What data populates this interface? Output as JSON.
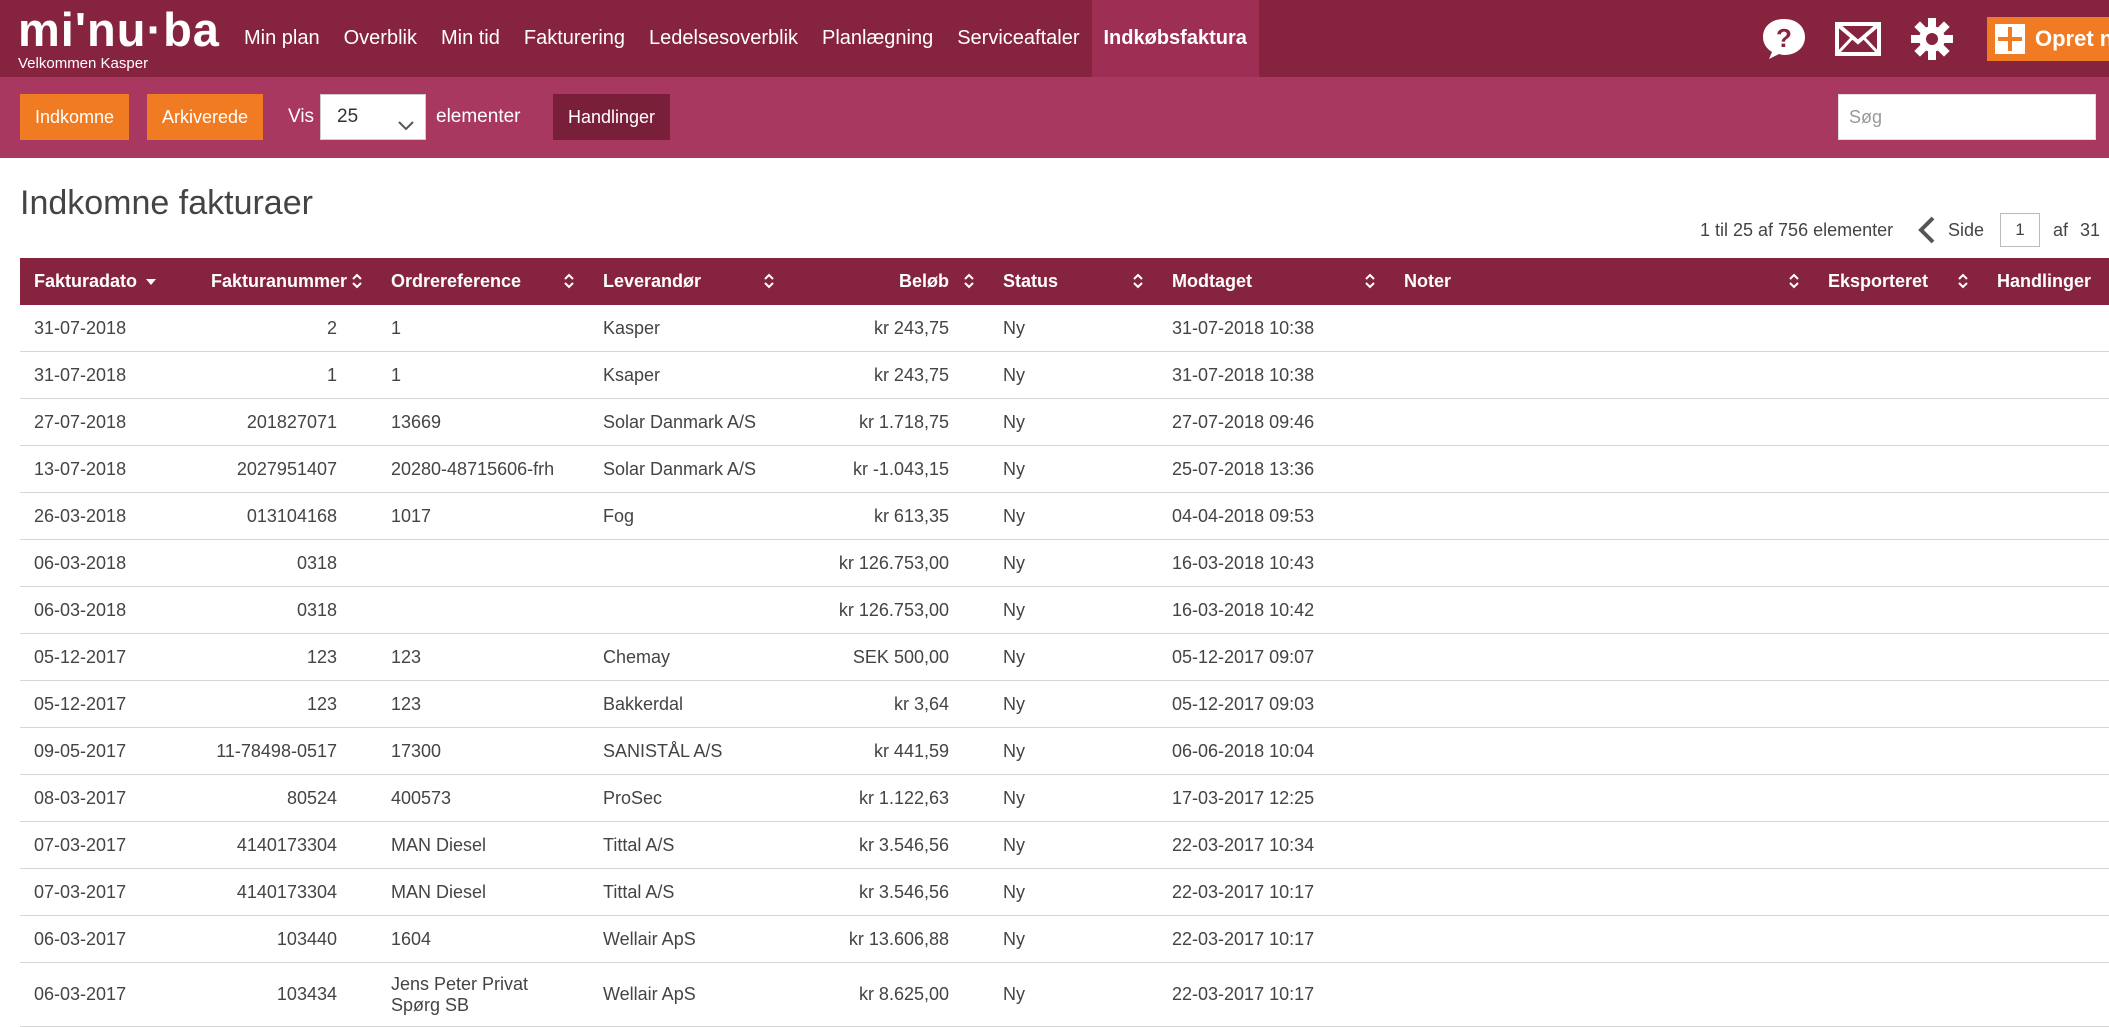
{
  "nav": {
    "logo_text": "mi'nu·ba",
    "welcome": "Velkommen  Kasper",
    "items": [
      {
        "label": "Min plan",
        "name": "nav-min-plan"
      },
      {
        "label": "Overblik",
        "name": "nav-overblik"
      },
      {
        "label": "Min tid",
        "name": "nav-min-tid"
      },
      {
        "label": "Fakturering",
        "name": "nav-fakturering"
      },
      {
        "label": "Ledelsesoverblik",
        "name": "nav-ledelsesoverblik"
      },
      {
        "label": "Planlægning",
        "name": "nav-planlaegning"
      },
      {
        "label": "Serviceaftaler",
        "name": "nav-serviceaftaler"
      },
      {
        "label": "Indkøbsfaktura",
        "name": "nav-indkobsfaktura",
        "active": true
      }
    ],
    "icons": [
      "help-icon",
      "mail-icon",
      "gear-icon"
    ],
    "create_label": "Opret n"
  },
  "toolbar": {
    "incoming_label": "Indkomne",
    "archived_label": "Arkiverede",
    "show_label": "Vis",
    "page_size": "25",
    "elements_label": "elementer",
    "actions_label": "Handlinger",
    "search_placeholder": "Søg"
  },
  "page": {
    "title": "Indkomne fakturaer",
    "range_text": "1 til 25 af 756 elementer",
    "page_label": "Side",
    "current_page": "1",
    "of_label": "af",
    "total_pages": "31"
  },
  "table": {
    "columns": [
      {
        "key": "date",
        "label": "Fakturadato",
        "sorted": true
      },
      {
        "key": "number",
        "label": "Fakturanummer",
        "align": "right"
      },
      {
        "key": "order_ref",
        "label": "Ordrereference"
      },
      {
        "key": "supplier",
        "label": "Leverandør"
      },
      {
        "key": "amount",
        "label": "Beløb",
        "align": "right"
      },
      {
        "key": "status",
        "label": "Status"
      },
      {
        "key": "received",
        "label": "Modtaget"
      },
      {
        "key": "notes",
        "label": "Noter"
      },
      {
        "key": "exported",
        "label": "Eksporteret"
      },
      {
        "key": "actions",
        "label": "Handlinger",
        "nosort": true
      }
    ],
    "rows": [
      {
        "date": "31-07-2018",
        "number": "2",
        "order_ref": "1",
        "supplier": "Kasper",
        "amount": "kr 243,75",
        "status": "Ny",
        "received": "31-07-2018 10:38"
      },
      {
        "date": "31-07-2018",
        "number": "1",
        "order_ref": "1",
        "supplier": "Ksaper",
        "amount": "kr 243,75",
        "status": "Ny",
        "received": "31-07-2018 10:38"
      },
      {
        "date": "27-07-2018",
        "number": "201827071",
        "order_ref": "13669",
        "supplier": "Solar Danmark A/S",
        "amount": "kr 1.718,75",
        "status": "Ny",
        "received": "27-07-2018 09:46"
      },
      {
        "date": "13-07-2018",
        "number": "2027951407",
        "order_ref": "20280-48715606-frh",
        "supplier": "Solar Danmark A/S",
        "amount": "kr -1.043,15",
        "status": "Ny",
        "received": "25-07-2018 13:36"
      },
      {
        "date": "26-03-2018",
        "number": "013104168",
        "order_ref": "1017",
        "supplier": "Fog",
        "amount": "kr 613,35",
        "status": "Ny",
        "received": "04-04-2018 09:53"
      },
      {
        "date": "06-03-2018",
        "number": "0318",
        "order_ref": "",
        "supplier": "",
        "amount": "kr 126.753,00",
        "status": "Ny",
        "received": "16-03-2018 10:43"
      },
      {
        "date": "06-03-2018",
        "number": "0318",
        "order_ref": "",
        "supplier": "",
        "amount": "kr 126.753,00",
        "status": "Ny",
        "received": "16-03-2018 10:42"
      },
      {
        "date": "05-12-2017",
        "number": "123",
        "order_ref": "123",
        "supplier": "Chemay",
        "amount": "SEK 500,00",
        "status": "Ny",
        "received": "05-12-2017 09:07"
      },
      {
        "date": "05-12-2017",
        "number": "123",
        "order_ref": "123",
        "supplier": "Bakkerdal",
        "amount": "kr 3,64",
        "status": "Ny",
        "received": "05-12-2017 09:03"
      },
      {
        "date": "09-05-2017",
        "number": "11-78498-0517",
        "order_ref": "17300",
        "supplier": "SANISTÅL A/S",
        "amount": "kr 441,59",
        "status": "Ny",
        "received": "06-06-2018 10:04"
      },
      {
        "date": "08-03-2017",
        "number": "80524",
        "order_ref": "400573",
        "supplier": "ProSec",
        "amount": "kr 1.122,63",
        "status": "Ny",
        "received": "17-03-2017 12:25"
      },
      {
        "date": "07-03-2017",
        "number": "4140173304",
        "order_ref": "MAN Diesel",
        "supplier": "Tittal A/S",
        "amount": "kr 3.546,56",
        "status": "Ny",
        "received": "22-03-2017 10:34"
      },
      {
        "date": "07-03-2017",
        "number": "4140173304",
        "order_ref": "MAN Diesel",
        "supplier": "Tittal A/S",
        "amount": "kr 3.546,56",
        "status": "Ny",
        "received": "22-03-2017 10:17"
      },
      {
        "date": "06-03-2017",
        "number": "103440",
        "order_ref": "1604",
        "supplier": "Wellair ApS",
        "amount": "kr 13.606,88",
        "status": "Ny",
        "received": "22-03-2017 10:17"
      },
      {
        "date": "06-03-2017",
        "number": "103434",
        "order_ref": "Jens Peter Privat Spørg SB",
        "supplier": "Wellair ApS",
        "amount": "kr 8.625,00",
        "status": "Ny",
        "received": "22-03-2017 10:17"
      }
    ]
  }
}
